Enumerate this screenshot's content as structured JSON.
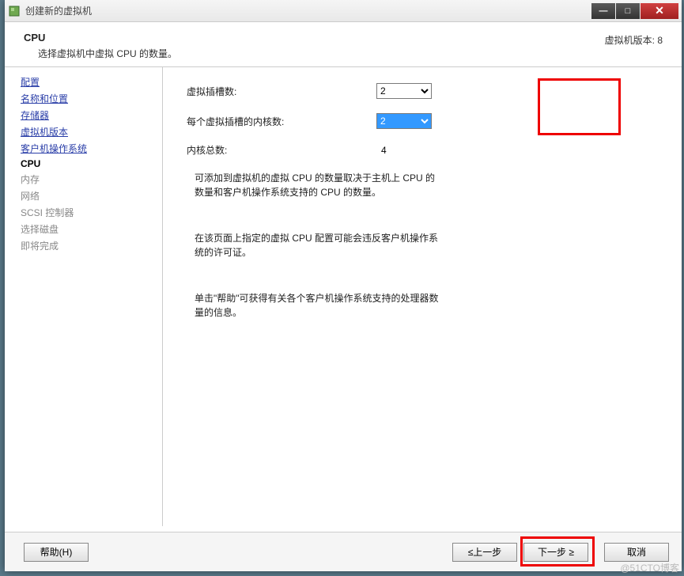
{
  "titlebar": {
    "title": "创建新的虚拟机"
  },
  "header": {
    "title": "CPU",
    "subtitle": "选择虚拟机中虚拟 CPU 的数量。",
    "vm_version": "虚拟机版本: 8"
  },
  "sidebar": {
    "items": [
      {
        "label": "配置",
        "state": "link"
      },
      {
        "label": "名称和位置",
        "state": "link"
      },
      {
        "label": "存储器",
        "state": "link"
      },
      {
        "label": "虚拟机版本",
        "state": "link"
      },
      {
        "label": "客户机操作系统",
        "state": "link"
      },
      {
        "label": "CPU",
        "state": "current"
      },
      {
        "label": "内存",
        "state": "future"
      },
      {
        "label": "网络",
        "state": "future"
      },
      {
        "label": "SCSI 控制器",
        "state": "future"
      },
      {
        "label": "选择磁盘",
        "state": "future"
      },
      {
        "label": "即将完成",
        "state": "future"
      }
    ]
  },
  "main": {
    "row1_label": "虚拟插槽数:",
    "row1_value": "2",
    "row2_label": "每个虚拟插槽的内核数:",
    "row2_value": "2",
    "row3_label": "内核总数:",
    "row3_value": "4",
    "info1": "可添加到虚拟机的虚拟 CPU 的数量取决于主机上 CPU 的数量和客户机操作系统支持的 CPU 的数量。",
    "info2": "在该页面上指定的虚拟 CPU 配置可能会违反客户机操作系统的许可证。",
    "info3": "单击\"帮助\"可获得有关各个客户机操作系统支持的处理器数量的信息。"
  },
  "footer": {
    "help": "帮助(H)",
    "back": "≤上一步",
    "next": "下一步 ≥",
    "cancel": "取消"
  },
  "watermark": "@51CTO博客"
}
